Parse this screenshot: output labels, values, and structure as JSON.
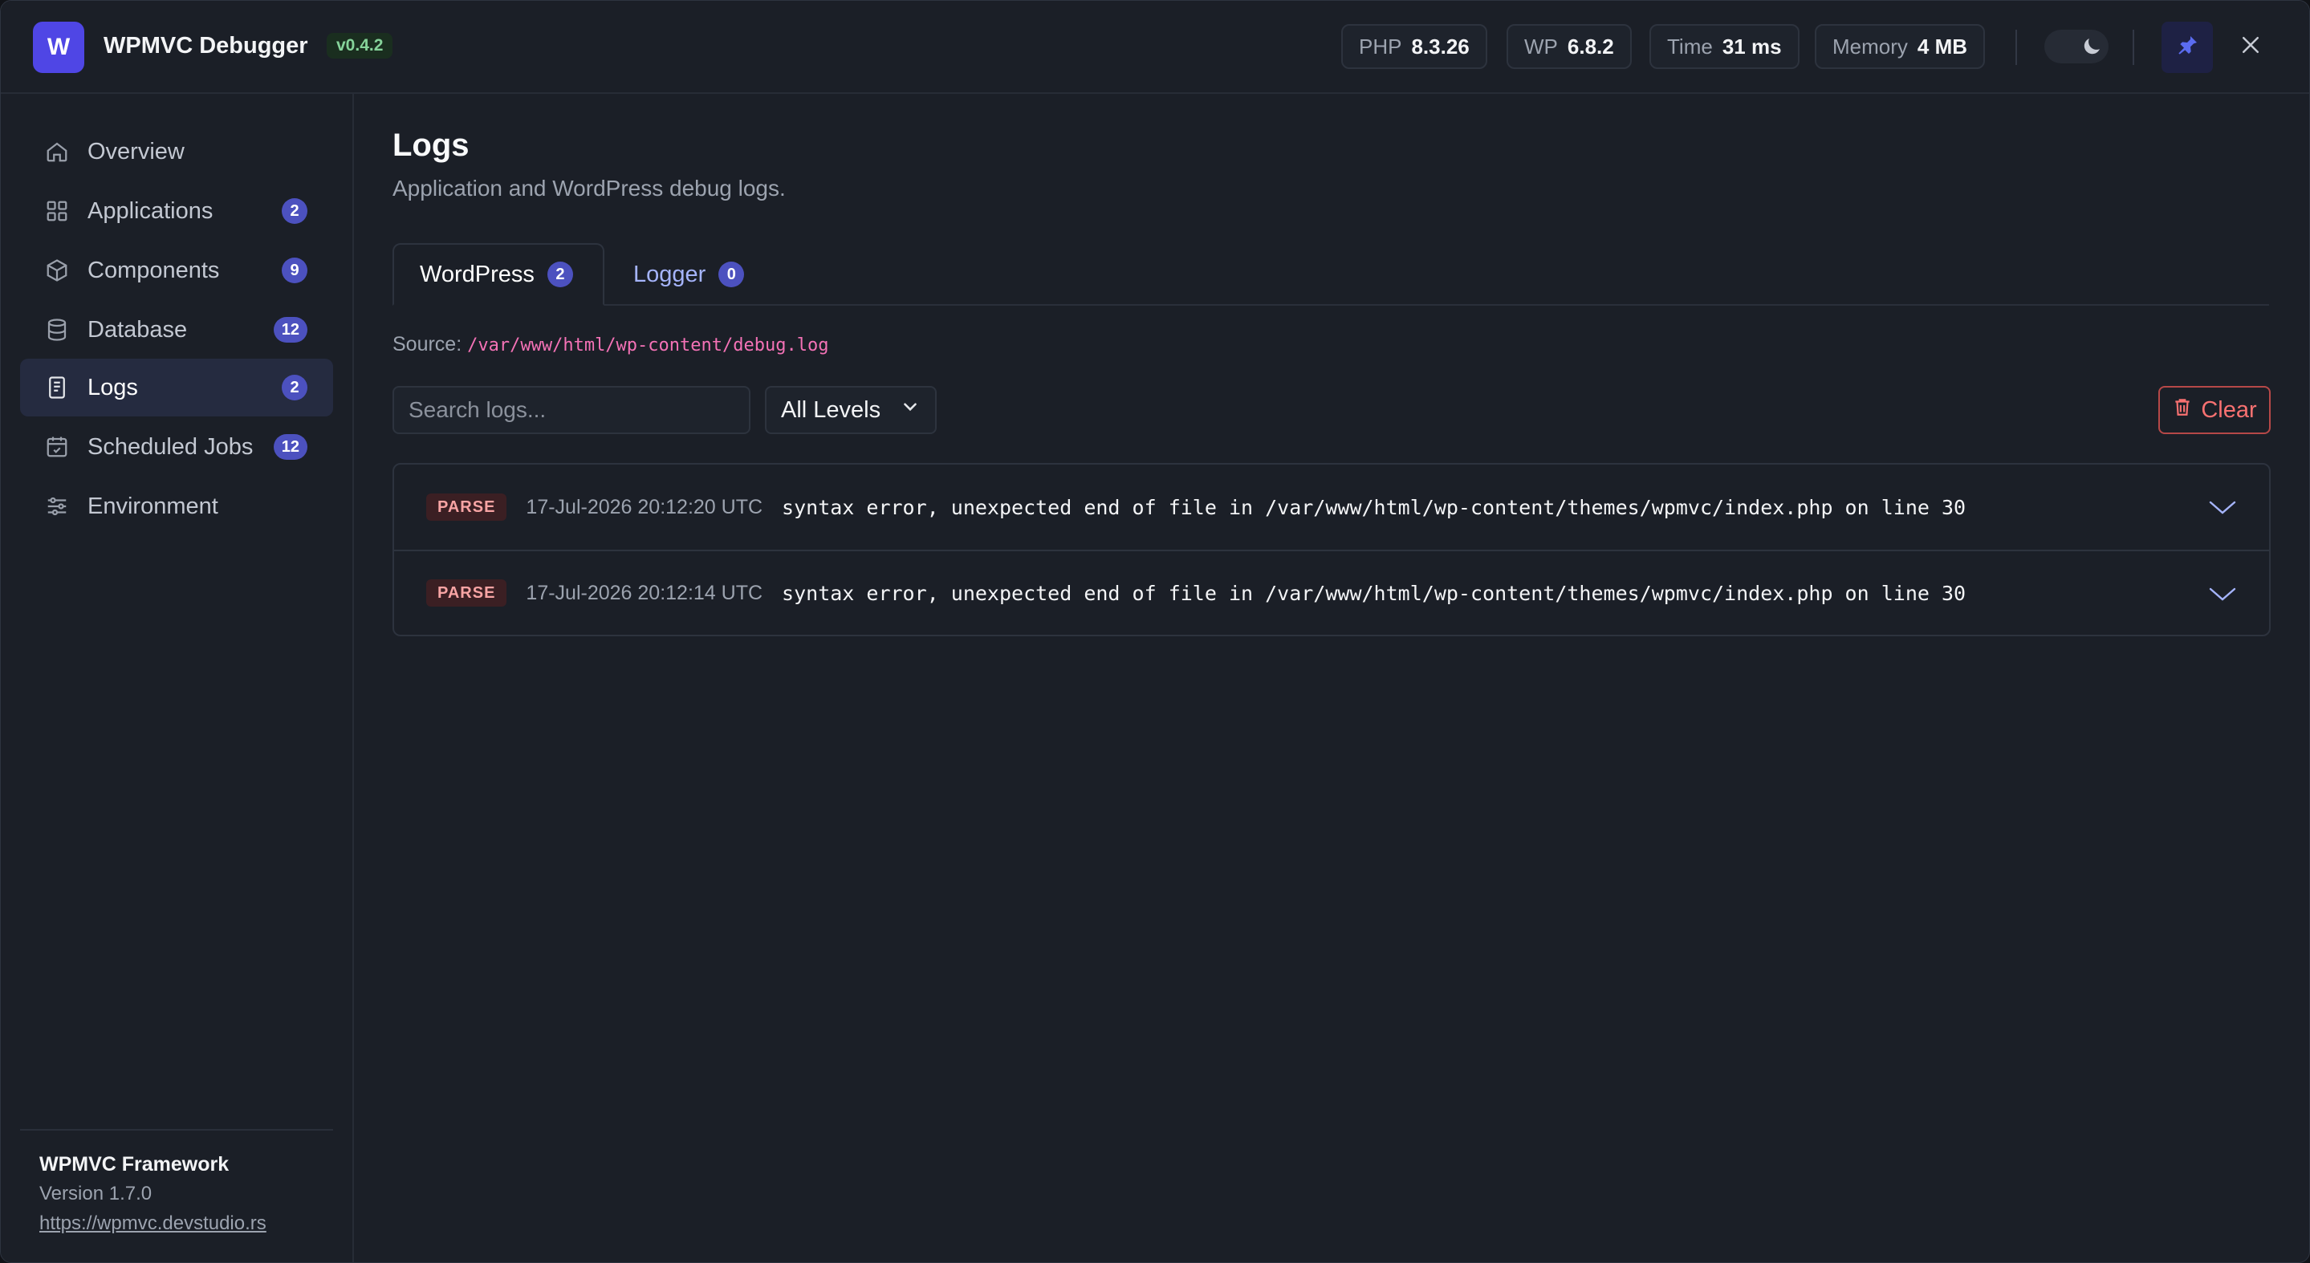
{
  "header": {
    "logo_letter": "W",
    "title": "WPMVC Debugger",
    "version": "v0.4.2",
    "stats": [
      {
        "key": "PHP",
        "value": "8.3.26"
      },
      {
        "key": "WP",
        "value": "6.8.2"
      },
      {
        "key": "Time",
        "value": "31 ms"
      },
      {
        "key": "Memory",
        "value": "4 MB"
      }
    ],
    "icons": [
      "moon-icon",
      "pin-icon",
      "close-icon"
    ]
  },
  "sidebar": {
    "items": [
      {
        "label": "Overview",
        "icon": "home-icon",
        "badge": ""
      },
      {
        "label": "Applications",
        "icon": "grid-icon",
        "badge": "2"
      },
      {
        "label": "Components",
        "icon": "cube-icon",
        "badge": "9"
      },
      {
        "label": "Database",
        "icon": "database-icon",
        "badge": "12"
      },
      {
        "label": "Logs",
        "icon": "document-icon",
        "badge": "2",
        "active": true
      },
      {
        "label": "Scheduled Jobs",
        "icon": "calendar-icon",
        "badge": "12"
      },
      {
        "label": "Environment",
        "icon": "sliders-icon",
        "badge": ""
      }
    ],
    "footer": {
      "name": "WPMVC Framework",
      "version": "Version 1.7.0",
      "link": "https://wpmvc.devstudio.rs"
    }
  },
  "main": {
    "title": "Logs",
    "subtitle": "Application and WordPress debug logs.",
    "tabs": [
      {
        "label": "WordPress",
        "count": "2",
        "active": true
      },
      {
        "label": "Logger",
        "count": "0",
        "active": false
      }
    ],
    "source_label": "Source:",
    "source_path": "/var/www/html/wp-content/debug.log",
    "search_placeholder": "Search logs...",
    "level_filter": "All Levels",
    "clear_label": "Clear",
    "logs": [
      {
        "level": "PARSE",
        "time": "17-Jul-2026 20:12:20 UTC",
        "message": "syntax error, unexpected end of file in /var/www/html/wp-content/themes/wpmvc/index.php on line 30"
      },
      {
        "level": "PARSE",
        "time": "17-Jul-2026 20:12:14 UTC",
        "message": "syntax error, unexpected end of file in /var/www/html/wp-content/themes/wpmvc/index.php on line 30"
      }
    ]
  },
  "colors": {
    "accent": "#4f46e5",
    "badge": "#4c51bf",
    "danger": "#f87171",
    "path": "#f472b6",
    "background": "#1b1f27"
  }
}
